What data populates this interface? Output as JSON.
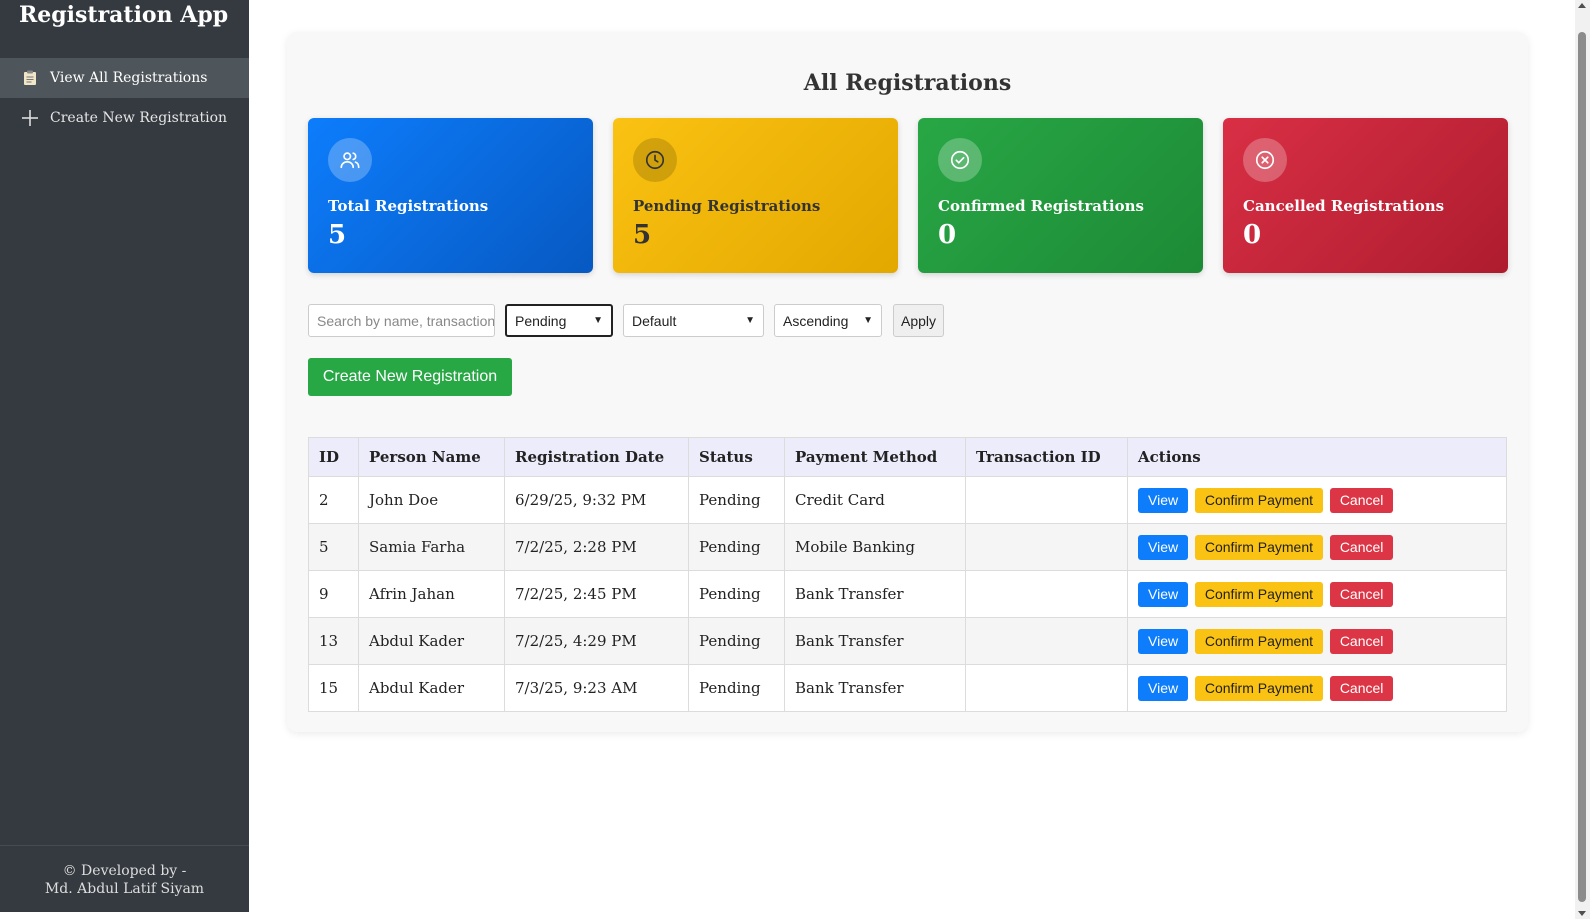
{
  "app": {
    "title": "Registration App"
  },
  "sidebar": {
    "items": [
      {
        "label": "View All Registrations",
        "icon": "clipboard-icon",
        "active": true
      },
      {
        "label": "Create New Registration",
        "icon": "plus-icon",
        "active": false
      }
    ],
    "footer_line1": "© Developed by -",
    "footer_line2": "Md. Abdul Latif Siyam"
  },
  "main": {
    "title": "All Registrations",
    "stats": [
      {
        "label": "Total Registrations",
        "value": "5",
        "icon": "users-icon",
        "color": "#0d6efd"
      },
      {
        "label": "Pending Registrations",
        "value": "5",
        "icon": "clock-icon",
        "color": "#ffc107"
      },
      {
        "label": "Confirmed Registrations",
        "value": "0",
        "icon": "check-circle-icon",
        "color": "#28a745"
      },
      {
        "label": "Cancelled Registrations",
        "value": "0",
        "icon": "x-circle-icon",
        "color": "#dc3545"
      }
    ],
    "filters": {
      "search_placeholder": "Search by name, transaction",
      "status_selected": "Pending",
      "sort_selected": "Default",
      "order_selected": "Ascending",
      "apply_label": "Apply"
    },
    "create_button_label": "Create New Registration",
    "table": {
      "headers": [
        "ID",
        "Person Name",
        "Registration Date",
        "Status",
        "Payment Method",
        "Transaction ID",
        "Actions"
      ],
      "rows": [
        {
          "id": "2",
          "name": "John Doe",
          "date": "6/29/25, 9:32 PM",
          "status": "Pending",
          "method": "Credit Card",
          "txn": ""
        },
        {
          "id": "5",
          "name": "Samia Farha",
          "date": "7/2/25, 2:28 PM",
          "status": "Pending",
          "method": "Mobile Banking",
          "txn": ""
        },
        {
          "id": "9",
          "name": "Afrin Jahan",
          "date": "7/2/25, 2:45 PM",
          "status": "Pending",
          "method": "Bank Transfer",
          "txn": ""
        },
        {
          "id": "13",
          "name": "Abdul Kader",
          "date": "7/2/25, 4:29 PM",
          "status": "Pending",
          "method": "Bank Transfer",
          "txn": ""
        },
        {
          "id": "15",
          "name": "Abdul Kader",
          "date": "7/3/25, 9:23 AM",
          "status": "Pending",
          "method": "Bank Transfer",
          "txn": ""
        }
      ],
      "actions": {
        "view": "View",
        "confirm": "Confirm Payment",
        "cancel": "Cancel"
      }
    }
  }
}
